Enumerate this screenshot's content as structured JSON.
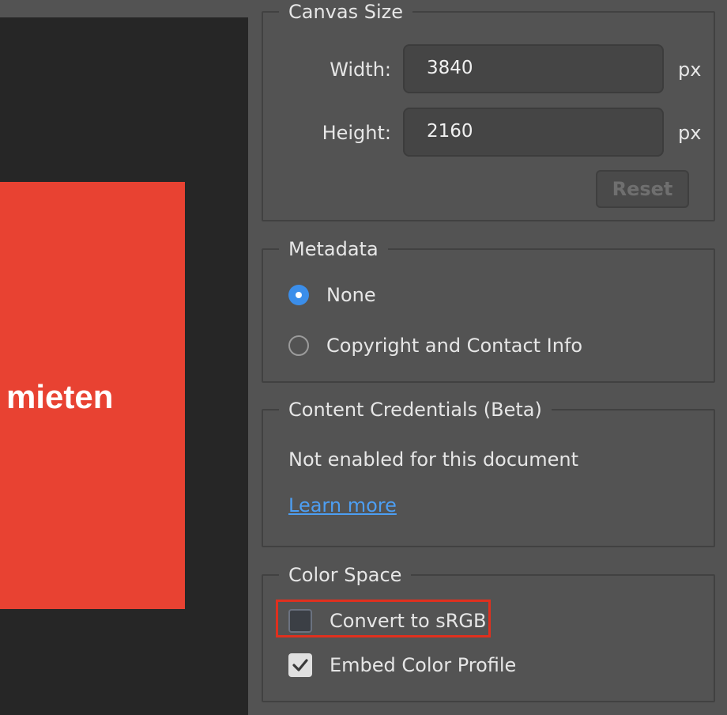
{
  "preview": {
    "text": "mieten",
    "accent_color": "#e84232"
  },
  "canvas_size": {
    "legend": "Canvas Size",
    "width_label": "Width:",
    "width_value": "3840",
    "height_label": "Height:",
    "height_value": "2160",
    "unit": "px",
    "reset_label": "Reset"
  },
  "metadata": {
    "legend": "Metadata",
    "options": [
      {
        "label": "None",
        "selected": true
      },
      {
        "label": "Copyright and Contact Info",
        "selected": false
      }
    ]
  },
  "content_credentials": {
    "legend": "Content Credentials (Beta)",
    "status": "Not enabled for this document",
    "link": "Learn more"
  },
  "color_space": {
    "legend": "Color Space",
    "convert_label": "Convert to sRGB",
    "convert_checked": false,
    "embed_label": "Embed Color Profile",
    "embed_checked": true,
    "highlight_color": "#e0301e"
  }
}
